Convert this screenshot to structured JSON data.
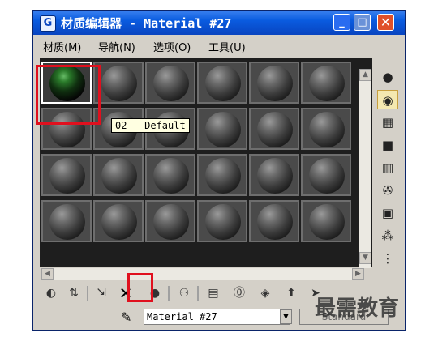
{
  "window": {
    "title": "材质编辑器 - Material #27",
    "minimize": "_",
    "maximize": "□",
    "close": "✕"
  },
  "menu": [
    {
      "label": "材质(M)"
    },
    {
      "label": "导航(N)"
    },
    {
      "label": "选项(O)"
    },
    {
      "label": "工具(U)"
    }
  ],
  "sample_slots": {
    "rows": 4,
    "cols": 6,
    "active_index": 0,
    "tooltip": "02 - Default"
  },
  "material_name": "Material #27",
  "material_type_button": "Standard",
  "watermark": "最需教育",
  "icons": {
    "right": [
      "sample-type-sphere-icon",
      "backlight-icon",
      "background-checker-icon",
      "sample-uv-tiling-icon",
      "video-color-check-icon",
      "make-preview-icon",
      "options-icon",
      "select-by-material-icon",
      "material-map-navigator-icon"
    ],
    "bottom": [
      "get-material-icon",
      "put-to-scene-icon",
      "assign-to-selection-icon",
      "reset-map-icon",
      "make-unique-icon",
      "put-to-library-icon",
      "material-id-channel-icon",
      "show-map-in-viewport-icon",
      "show-end-result-icon",
      "go-to-parent-icon",
      "go-forward-to-sibling-icon"
    ]
  },
  "colors": {
    "highlight": "#e0101e",
    "titlebar": "#0a5ce0",
    "panel": "#1e1e1e"
  }
}
